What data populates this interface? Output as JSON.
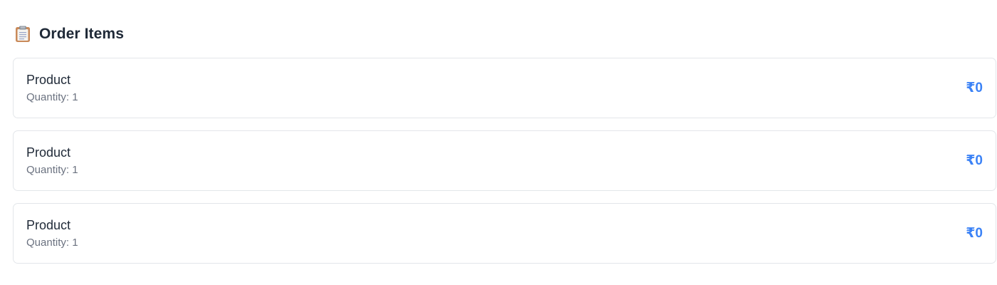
{
  "section": {
    "title": "Order Items",
    "icon": "clipboard-icon"
  },
  "items": [
    {
      "name": "Product",
      "quantity_label": "Quantity:",
      "quantity": "1",
      "price": "₹0"
    },
    {
      "name": "Product",
      "quantity_label": "Quantity:",
      "quantity": "1",
      "price": "₹0"
    },
    {
      "name": "Product",
      "quantity_label": "Quantity:",
      "quantity": "1",
      "price": "₹0"
    }
  ],
  "colors": {
    "accent": "#3b82f6",
    "title": "#1f2937",
    "muted": "#6b7280",
    "border": "#e3e6ea"
  }
}
